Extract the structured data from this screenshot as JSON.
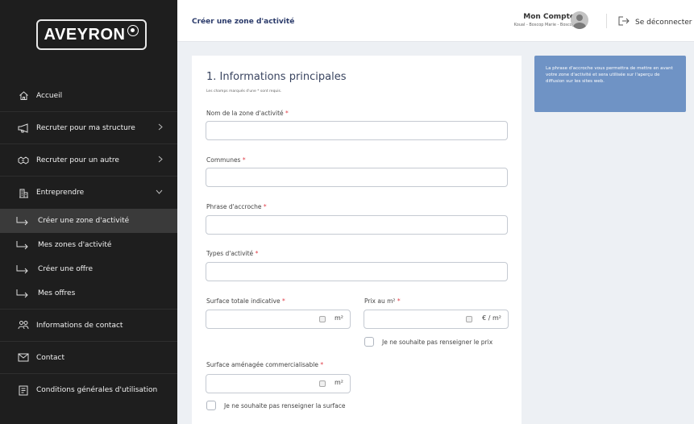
{
  "brand": {
    "logo_text": "AVEYRON"
  },
  "header": {
    "title": "Créer une zone d'activité",
    "account_name": "Mon Compte",
    "account_sub": "Koual - Boscop Marie - Boscop",
    "logout_label": "Se déconnecter"
  },
  "sidebar": {
    "items": [
      {
        "label": "Accueil",
        "icon": "home-icon"
      },
      {
        "label": "Recruter pour ma structure",
        "icon": "megaphone-icon"
      },
      {
        "label": "Recruter pour un autre",
        "icon": "handshake-icon"
      },
      {
        "label": "Entreprendre",
        "icon": "building-icon"
      }
    ],
    "sub_items": [
      {
        "label": "Créer une zone d'activité"
      },
      {
        "label": "Mes zones d'activité"
      },
      {
        "label": "Créer une offre"
      },
      {
        "label": "Mes offres"
      }
    ],
    "bottom_items": [
      {
        "label": "Informations de contact",
        "icon": "people-icon"
      },
      {
        "label": "Contact",
        "icon": "mail-icon"
      },
      {
        "label": "Conditions générales d'utilisation",
        "icon": "document-icon"
      }
    ]
  },
  "form": {
    "section_title": "1. Informations principales",
    "required_note": "Les champs marqués d'une * sont requis.",
    "fields": {
      "name": {
        "label": "Nom de la zone d'activité",
        "value": ""
      },
      "communes": {
        "label": "Communes",
        "value": ""
      },
      "tagline": {
        "label": "Phrase d'accroche",
        "value": ""
      },
      "activity_types": {
        "label": "Types d'activité",
        "value": ""
      },
      "total_area": {
        "label": "Surface totale indicative",
        "unit": "m²",
        "value": ""
      },
      "price": {
        "label": "Prix au m²",
        "unit": "€ / m²",
        "value": ""
      },
      "commercial_area": {
        "label": "Surface aménagée commercialisable",
        "unit": "m²",
        "value": ""
      }
    },
    "required_marker": "*",
    "price_checkbox_label": "Je ne souhaite pas renseigner le prix",
    "area_checkbox_label": "Je ne souhaite pas renseigner la surface"
  },
  "help": {
    "text": "La phrase d'accroche vous permettra de mettre en avant votre zone d'activité et sera utilisée sur l'aperçu de diffusion sur les sites web."
  },
  "colors": {
    "sidebar_bg": "#1e1e1e",
    "help_bg": "#6f93c5",
    "required": "#e0404a",
    "title": "#2a3a6a"
  }
}
